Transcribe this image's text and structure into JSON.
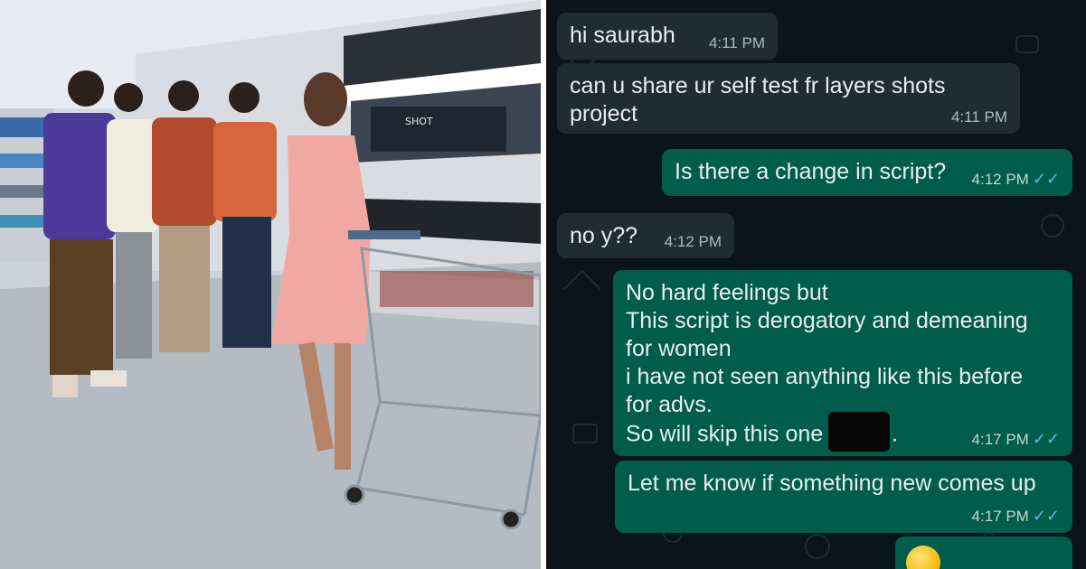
{
  "scene": {
    "description_icon": "store-scene-photo",
    "shelf_sign": "SHOT"
  },
  "chat": {
    "colors": {
      "background": "#0b141a",
      "incoming": "#202c33",
      "outgoing": "#005c4b",
      "read_ticks": "#53bdeb"
    },
    "messages": [
      {
        "dir": "in",
        "text": "hi saurabh",
        "time": "4:11 PM"
      },
      {
        "dir": "in",
        "text": "can u share ur self test fr layers shots\nproject",
        "time": "4:11 PM"
      },
      {
        "dir": "out",
        "text": "Is there a change in script?",
        "time": "4:12 PM",
        "status": "✓✓"
      },
      {
        "dir": "in",
        "text": "no y??",
        "time": "4:12 PM"
      },
      {
        "dir": "out",
        "text": "No hard feelings but\nThis script is derogatory and demeaning\nfor women\ni have not seen anything  like this before\nfor advs.",
        "text_tail": "So will skip this one",
        "tail_end": ".",
        "time": "4:17 PM",
        "status": "✓✓"
      },
      {
        "dir": "out",
        "text": "Let me know if something new comes up",
        "time": "4:17 PM",
        "status": "✓✓"
      }
    ]
  }
}
